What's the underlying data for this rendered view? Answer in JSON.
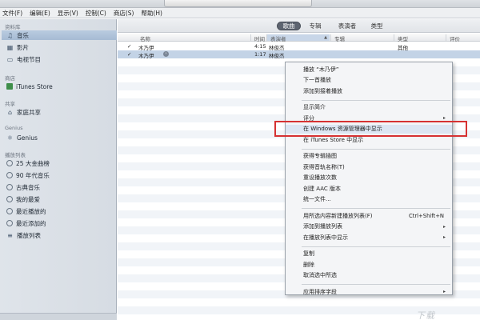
{
  "menubar": [
    "文件(F)",
    "编辑(E)",
    "显示(V)",
    "控制(C)",
    "商店(S)",
    "帮助(H)"
  ],
  "sidebar": {
    "library_heading": "资料库",
    "library": [
      {
        "label": "音乐",
        "icon": "music-note-icon",
        "selected": true
      },
      {
        "label": "影片",
        "icon": "film-icon"
      },
      {
        "label": "电视节目",
        "icon": "tv-icon"
      }
    ],
    "store_heading": "商店",
    "store": [
      {
        "label": "iTunes Store",
        "icon": "store-icon"
      }
    ],
    "shared_heading": "共享",
    "shared": [
      {
        "label": "家庭共享",
        "icon": "home-icon"
      }
    ],
    "genius_heading": "Genius",
    "genius": [
      {
        "label": "Genius",
        "icon": "genius-icon"
      }
    ],
    "playlists_heading": "播放列表",
    "playlists": [
      {
        "label": "25 大金曲榜",
        "icon": "smart-playlist-gear-icon"
      },
      {
        "label": "90 年代音乐",
        "icon": "smart-playlist-gear-icon"
      },
      {
        "label": "古典音乐",
        "icon": "smart-playlist-gear-icon"
      },
      {
        "label": "我的最爱",
        "icon": "smart-playlist-gear-icon"
      },
      {
        "label": "最近播放的",
        "icon": "smart-playlist-gear-icon"
      },
      {
        "label": "最近添加的",
        "icon": "smart-playlist-gear-icon"
      },
      {
        "label": "播放列表",
        "icon": "playlist-icon"
      }
    ]
  },
  "tabs": [
    "歌曲",
    "专辑",
    "表演者",
    "类型"
  ],
  "active_tab": "歌曲",
  "columns": {
    "name": "名称",
    "time": "时间",
    "artist": "表演者",
    "album": "专辑",
    "genre": "类型",
    "rating": "评价"
  },
  "songs": [
    {
      "check": "✓",
      "name": "木乃伊",
      "time": "4:15",
      "artist": "林俊杰",
      "album": "",
      "genre": "其他"
    },
    {
      "check": "✓",
      "name": "木乃伊",
      "time": "1:17",
      "artist": "林俊杰",
      "album": "",
      "genre": ""
    }
  ],
  "context_menu": {
    "items": [
      {
        "label": "播放 “木乃伊”"
      },
      {
        "label": "下一首播放"
      },
      {
        "label": "添加到接着播放"
      },
      {
        "sep": true
      },
      {
        "label": "显示简介"
      },
      {
        "label": "评分",
        "submenu": true
      },
      {
        "label": "在 Windows 资源管理器中显示",
        "highlight": true
      },
      {
        "label": "在 iTunes Store 中显示"
      },
      {
        "sep": true
      },
      {
        "label": "获得专辑插图"
      },
      {
        "label": "获得音轨名称(T)"
      },
      {
        "label": "重设播放次数"
      },
      {
        "label": "创建 AAC 版本"
      },
      {
        "label": "统一文件..."
      },
      {
        "sep": true
      },
      {
        "label": "用所选内容新建播放列表(F)",
        "shortcut": "Ctrl+Shift+N"
      },
      {
        "label": "添加到播放列表",
        "submenu": true
      },
      {
        "label": "在播放列表中显示",
        "submenu": true
      },
      {
        "sep": true
      },
      {
        "label": "复制"
      },
      {
        "label": "删除"
      },
      {
        "label": "取消选中所选"
      },
      {
        "sep": true
      },
      {
        "label": "应用排序字段",
        "submenu": true
      }
    ]
  },
  "accent_colors": {
    "selection": "#c3d3e6",
    "annotation": "#d63232",
    "active_tab": "#5d6470"
  }
}
